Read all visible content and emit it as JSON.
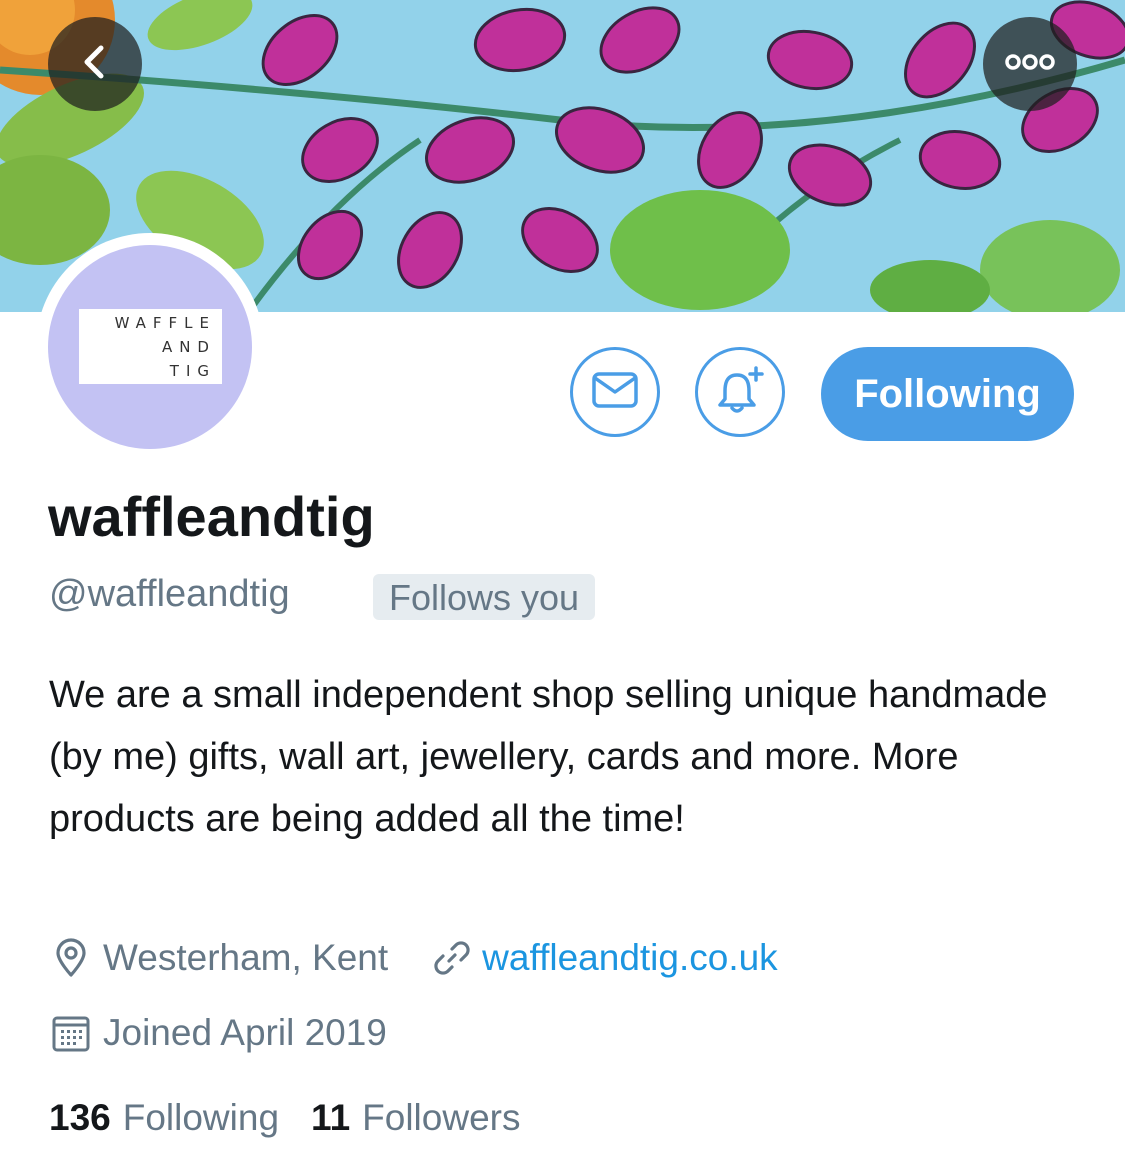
{
  "header": {
    "back_icon": "chevron-left-icon",
    "more_icon": "ellipsis-icon"
  },
  "avatar": {
    "logo_lines": [
      "WAFFLE",
      "AND",
      "TIG"
    ],
    "background": "#c3c2f3"
  },
  "actions": {
    "message_icon": "envelope-icon",
    "notify_icon": "bell-plus-icon",
    "following_label": "Following",
    "accent": "#4a9de6"
  },
  "profile": {
    "display_name": "waffleandtig",
    "handle": "@waffleandtig",
    "follows_you": "Follows you",
    "bio": "We are a small independent shop selling unique handmade (by me) gifts, wall art, jewellery, cards and more. More products are being added all the time!",
    "location": "Westerham, Kent",
    "website": "waffleandtig.co.uk",
    "joined": "Joined April 2019",
    "location_icon": "location-pin-icon",
    "link_icon": "link-icon",
    "calendar_icon": "calendar-icon"
  },
  "stats": {
    "following_count": "136",
    "following_label": "Following",
    "followers_count": "11",
    "followers_label": "Followers"
  }
}
